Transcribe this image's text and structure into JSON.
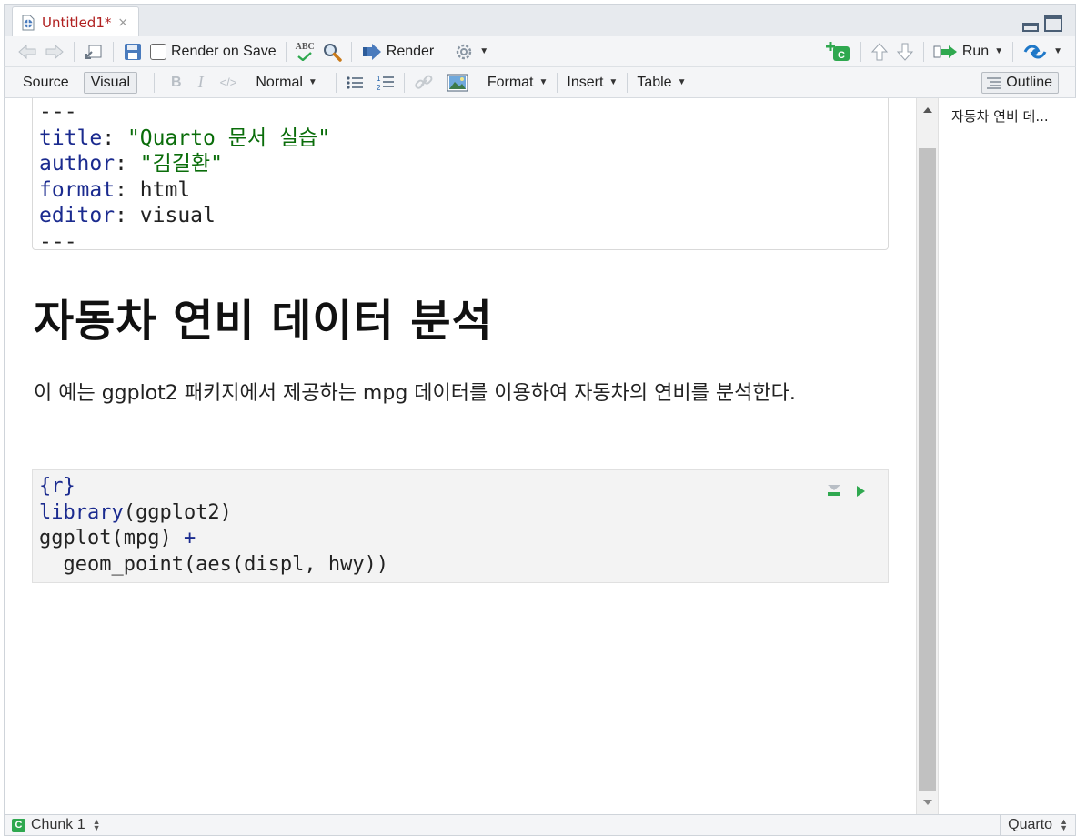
{
  "tab": {
    "title": "Untitled1*",
    "close": "×"
  },
  "toolbar1": {
    "render_on_save": "Render on Save",
    "render": "Render",
    "run": "Run",
    "abc": "ABC"
  },
  "toolbar2": {
    "source": "Source",
    "visual": "Visual",
    "normal": "Normal",
    "format": "Format",
    "insert": "Insert",
    "table": "Table",
    "outline": "Outline"
  },
  "yaml": {
    "delim": "---",
    "title_key": "title",
    "title_val": "\"Quarto 문서 실습\"",
    "author_key": "author",
    "author_val": "\"김길환\"",
    "format_key": "format",
    "format_val": "html",
    "editor_key": "editor",
    "editor_val": "visual"
  },
  "heading": "자동차 연비 데이터 분석",
  "paragraph": "이 예는 ggplot2 패키지에서 제공하는 mpg 데이터를 이용하여 자동차의 연비를 분석한다.",
  "chunk": {
    "header": "{r}",
    "line1_fn": "library",
    "line1_arg": "(ggplot2)",
    "line2_a": "ggplot(mpg) ",
    "line2_plus": "+",
    "line3_a": "  geom_point(aes(displ, hwy))"
  },
  "outline": {
    "item": "자동차 연비 데..."
  },
  "status": {
    "chunk": "Chunk 1",
    "lang": "Quarto",
    "badge": "C"
  },
  "colors": {
    "accent_green": "#2fa84f",
    "yaml_key": "#1b2b8f",
    "yaml_string": "#0a6d0a",
    "tab_title": "#b02020"
  }
}
